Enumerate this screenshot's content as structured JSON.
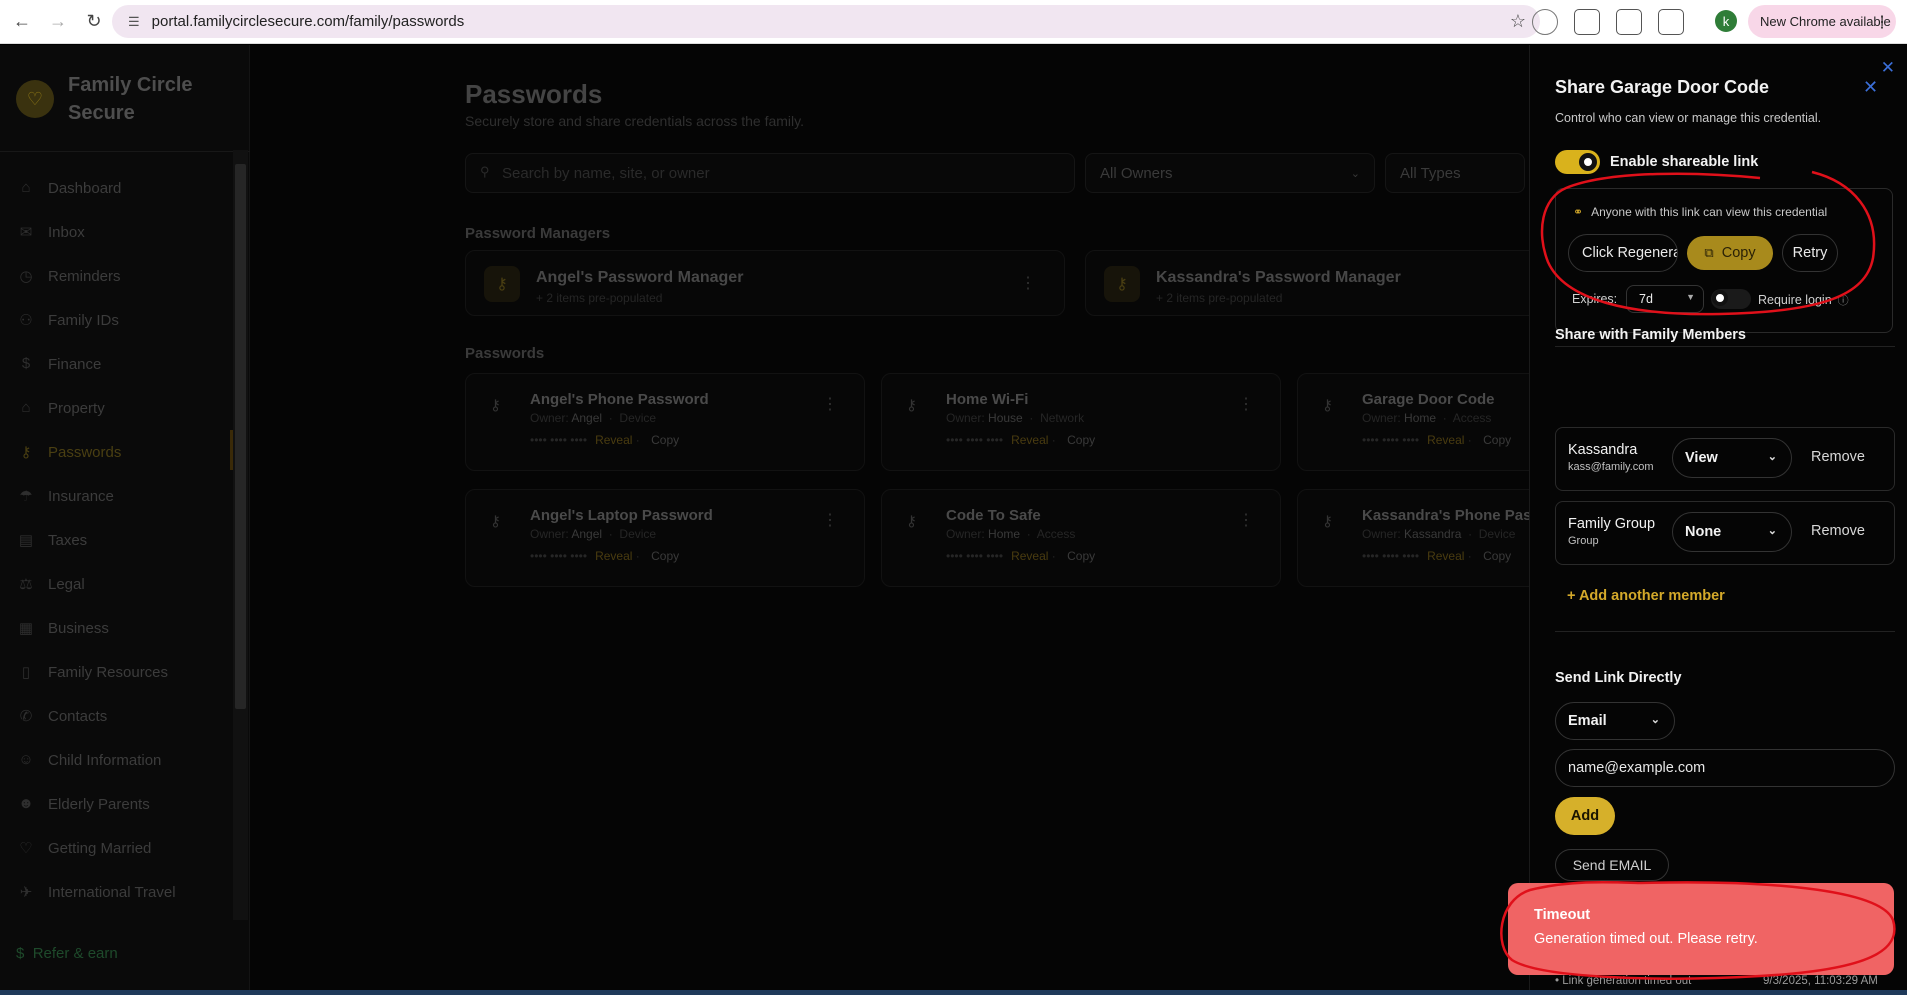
{
  "browser": {
    "url": "portal.familycirclesecure.com/family/passwords",
    "profile_initial": "k",
    "new_chrome_label": "New Chrome available"
  },
  "sidebar": {
    "brand": "Family Circle Secure",
    "items": [
      {
        "label": "Dashboard",
        "icon": "home-icon"
      },
      {
        "label": "Inbox",
        "icon": "inbox-icon"
      },
      {
        "label": "Reminders",
        "icon": "clock-icon"
      },
      {
        "label": "Family IDs",
        "icon": "users-icon"
      },
      {
        "label": "Finance",
        "icon": "dollar-icon"
      },
      {
        "label": "Property",
        "icon": "house-icon"
      },
      {
        "label": "Passwords",
        "icon": "key-icon",
        "active": true
      },
      {
        "label": "Insurance",
        "icon": "umbrella-icon"
      },
      {
        "label": "Taxes",
        "icon": "receipt-icon"
      },
      {
        "label": "Legal",
        "icon": "scale-icon"
      },
      {
        "label": "Business",
        "icon": "building-icon"
      },
      {
        "label": "Family Resources",
        "icon": "book-icon"
      },
      {
        "label": "Contacts",
        "icon": "phone-icon"
      },
      {
        "label": "Child Information",
        "icon": "smile-icon"
      },
      {
        "label": "Elderly Parents",
        "icon": "user-heart-icon"
      },
      {
        "label": "Getting Married",
        "icon": "heart-icon"
      },
      {
        "label": "International Travel",
        "icon": "plane-icon"
      }
    ],
    "refer_label": "Refer & earn"
  },
  "main": {
    "title": "Passwords",
    "subtitle": "Securely store and share credentials across the family.",
    "search_placeholder": "Search by name, site, or owner",
    "filter_owner": "All Owners",
    "filter_type": "All Types",
    "managers_heading": "Password Managers",
    "managers": [
      {
        "name": "Angel's Password Manager",
        "sub": "+ 2 items pre-populated"
      },
      {
        "name": "Kassandra's Password Manager",
        "sub": "+ 2 items pre-populated"
      }
    ],
    "passwords_heading": "Passwords",
    "owner_label": "Owner:",
    "reveal_label": "Reveal",
    "copy_label": "Copy",
    "masked": "•••• •••• ••••",
    "passwords": [
      {
        "name": "Angel's Phone Password",
        "owner": "Angel",
        "type": "Device"
      },
      {
        "name": "Home Wi-Fi",
        "owner": "House",
        "type": "Network"
      },
      {
        "name": "Garage Door Code",
        "owner": "Home",
        "type": "Access"
      },
      {
        "name": "Angel's Laptop Password",
        "owner": "Angel",
        "type": "Device"
      },
      {
        "name": "Code To Safe",
        "owner": "Home",
        "type": "Access"
      },
      {
        "name": "Kassandra's Phone Passw",
        "owner": "Kassandra",
        "type": "Device"
      }
    ]
  },
  "drawer": {
    "title": "Share Garage Door Code",
    "subtitle": "Control who can view or manage this credential.",
    "toggle_label": "Enable shareable link",
    "link_info": "Anyone with this link can view this credential",
    "regenerate_label": "Click Regenerate",
    "copy_label": "Copy",
    "retry_label": "Retry",
    "expires_label": "Expires:",
    "expires_value": "7d",
    "require_login_label": "Require login",
    "members_heading": "Share with Family Members",
    "members": [
      {
        "name": "Kassandra",
        "sub": "kass@family.com",
        "permission": "View"
      },
      {
        "name": "Family Group",
        "sub": "Group",
        "permission": "None"
      }
    ],
    "remove_label": "Remove",
    "add_member_label": "+ Add another member",
    "send_heading": "Send Link Directly",
    "send_method": "Email",
    "email_placeholder": "name@example.com",
    "add_label": "Add",
    "send_label": "Send EMAIL",
    "log_text": "• Link generation timed out",
    "log_time": "9/3/2025, 11:03:29 AM"
  },
  "toast": {
    "title": "Timeout",
    "message": "Generation timed out. Please retry.",
    "color": "#f06464"
  },
  "colors": {
    "accent": "#d6b02a",
    "annotation": "#e0101a"
  }
}
